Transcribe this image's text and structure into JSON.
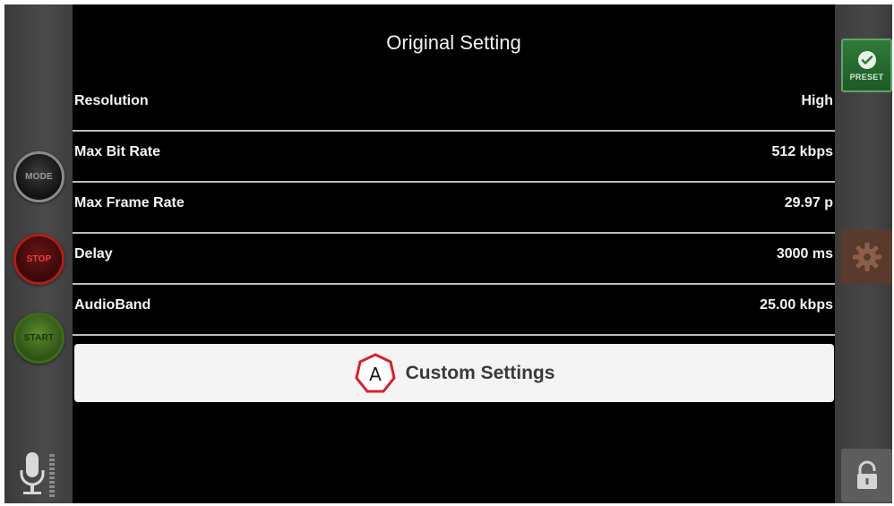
{
  "left_rail": {
    "mode_label": "MODE",
    "stop_label": "STOP",
    "start_label": "START"
  },
  "main": {
    "title": "Original Setting",
    "settings": [
      {
        "label": "Resolution",
        "value": "High"
      },
      {
        "label": "Max Bit Rate",
        "value": "512 kbps"
      },
      {
        "label": "Max Frame Rate",
        "value": "29.97 p"
      },
      {
        "label": "Delay",
        "value": "3000 ms"
      },
      {
        "label": "AudioBand",
        "value": "25.00 kbps"
      }
    ],
    "custom_button": {
      "badge_letter": "A",
      "label": "Custom Settings"
    }
  },
  "right_rail": {
    "preset_label": "PRESET"
  },
  "icons": {
    "mic": "microphone-icon",
    "check": "check-icon",
    "gear": "gear-icon",
    "lock": "lock-icon",
    "badge": "hexagon-badge-icon"
  },
  "colors": {
    "panel_bg": "#000000",
    "rail_bg": "#444444",
    "stop_red": "#b01c1c",
    "start_green": "#3f6a1d",
    "preset_green": "#2f7a3a",
    "gear_brown": "#5b3a2e",
    "badge_red": "#d8202a"
  }
}
